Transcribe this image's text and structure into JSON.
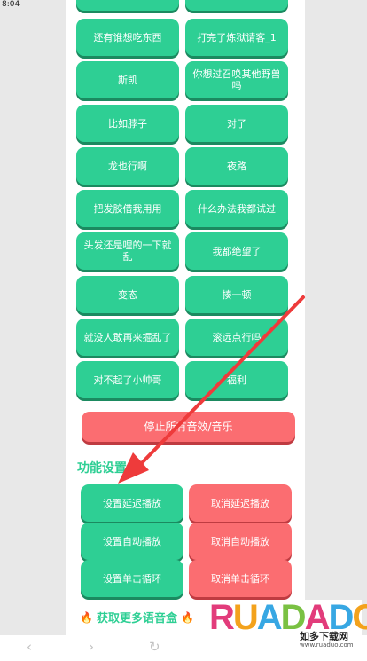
{
  "status_bar": {
    "time": "8:04"
  },
  "sound_buttons": [
    {
      "left": "",
      "right": ""
    },
    {
      "left": "还有谁想吃东西",
      "right": "打完了炼狱请客_1"
    },
    {
      "left": "斯凯",
      "right": "你想过召唤其他野兽吗"
    },
    {
      "left": "比如脖子",
      "right": "对了"
    },
    {
      "left": "龙也行啊",
      "right": "夜路"
    },
    {
      "left": "把发胶借我用用",
      "right": "什么办法我都试过"
    },
    {
      "left": "头发还是哩的一下就乱",
      "right": "我都绝望了"
    },
    {
      "left": "变态",
      "right": "揍一顿"
    },
    {
      "left": "就没人敢再来掘乱了",
      "right": "滚远点行吗"
    },
    {
      "left": "对不起了小帅哥",
      "right": "福利"
    }
  ],
  "stop_button": "停止所有音效/音乐",
  "settings": {
    "title": "功能设置",
    "buttons": [
      {
        "set": "设置延迟播放",
        "cancel": "取消延迟播放"
      },
      {
        "set": "设置自动播放",
        "cancel": "取消自动播放"
      },
      {
        "set": "设置单击循环",
        "cancel": "取消单击循环"
      }
    ]
  },
  "more_link": "获取更多语音盒",
  "nav": {
    "back": "‹",
    "forward": "›",
    "reload": "↻",
    "share": "⇧"
  },
  "watermark": {
    "brand": "RUANDADO",
    "cn": "如多下载网",
    "url": "www.ruaduo.com"
  },
  "colors": {
    "green": "#2ecf94",
    "red": "#fb6d71",
    "arrow": "#ee3b3b"
  }
}
